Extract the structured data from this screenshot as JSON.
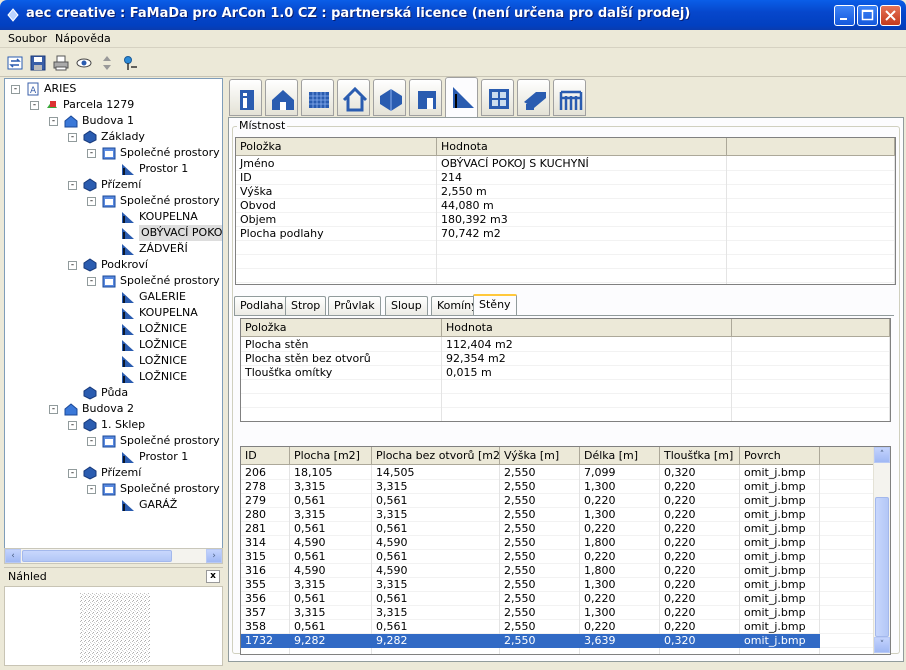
{
  "window": {
    "title": "aec creative : FaMaDa pro ArCon 1.0 CZ : partnerská licence (není určena pro další prodej)"
  },
  "menu": [
    "Soubor",
    "Nápověda"
  ],
  "toolbar": [
    {
      "name": "refresh-icon"
    },
    {
      "name": "save-icon"
    },
    {
      "name": "print-icon"
    },
    {
      "name": "view-icon"
    },
    {
      "name": "move-icon"
    },
    {
      "name": "pin-icon"
    }
  ],
  "tree": [
    {
      "label": "ARIES",
      "level": 0,
      "exp": "-",
      "icon": "project-icon"
    },
    {
      "label": "Parcela 1279",
      "level": 1,
      "exp": "-",
      "icon": "parcel-icon"
    },
    {
      "label": "Budova 1",
      "level": 2,
      "exp": "-",
      "icon": "building-icon"
    },
    {
      "label": "Základy",
      "level": 3,
      "exp": "-",
      "icon": "floor-icon"
    },
    {
      "label": "Společné prostory",
      "level": 4,
      "exp": "-",
      "icon": "space-group-icon"
    },
    {
      "label": "Prostor 1",
      "level": 5,
      "exp": "",
      "icon": "room-icon"
    },
    {
      "label": "Přízemí",
      "level": 3,
      "exp": "-",
      "icon": "floor-icon"
    },
    {
      "label": "Společné prostory",
      "level": 4,
      "exp": "-",
      "icon": "space-group-icon"
    },
    {
      "label": "KOUPELNA",
      "level": 5,
      "exp": "",
      "icon": "room-icon"
    },
    {
      "label": "OBÝVACÍ POKO",
      "level": 5,
      "exp": "",
      "icon": "room-icon",
      "selected": true
    },
    {
      "label": "ZÁDVEŘÍ",
      "level": 5,
      "exp": "",
      "icon": "room-icon"
    },
    {
      "label": "Podkroví",
      "level": 3,
      "exp": "-",
      "icon": "floor-icon"
    },
    {
      "label": "Společné prostory",
      "level": 4,
      "exp": "-",
      "icon": "space-group-icon"
    },
    {
      "label": "GALERIE",
      "level": 5,
      "exp": "",
      "icon": "room-icon"
    },
    {
      "label": "KOUPELNA",
      "level": 5,
      "exp": "",
      "icon": "room-icon"
    },
    {
      "label": "LOŽNICE",
      "level": 5,
      "exp": "",
      "icon": "room-icon"
    },
    {
      "label": "LOŽNICE",
      "level": 5,
      "exp": "",
      "icon": "room-icon"
    },
    {
      "label": "LOŽNICE",
      "level": 5,
      "exp": "",
      "icon": "room-icon"
    },
    {
      "label": "LOŽNICE",
      "level": 5,
      "exp": "",
      "icon": "room-icon"
    },
    {
      "label": "Půda",
      "level": 3,
      "exp": "",
      "icon": "floor-icon"
    },
    {
      "label": "Budova 2",
      "level": 2,
      "exp": "-",
      "icon": "building-icon"
    },
    {
      "label": "1. Sklep",
      "level": 3,
      "exp": "-",
      "icon": "floor-icon"
    },
    {
      "label": "Společné prostory",
      "level": 4,
      "exp": "-",
      "icon": "space-group-icon"
    },
    {
      "label": "Prostor 1",
      "level": 5,
      "exp": "",
      "icon": "room-icon"
    },
    {
      "label": "Přízemí",
      "level": 3,
      "exp": "-",
      "icon": "floor-icon"
    },
    {
      "label": "Společné prostory",
      "level": 4,
      "exp": "-",
      "icon": "space-group-icon"
    },
    {
      "label": "GARÁŽ",
      "level": 5,
      "exp": "",
      "icon": "room-icon"
    }
  ],
  "preview": {
    "title": "Náhled",
    "close": "x"
  },
  "big_tabs": [
    "info-icon",
    "building-icon",
    "parcel-grid-icon",
    "house-arrow-icon",
    "floor-icon",
    "door-icon",
    "room-icon",
    "window-icon",
    "roof-icon",
    "railing-icon"
  ],
  "room": {
    "group_label": "Místnost",
    "headers": [
      "Položka",
      "Hodnota"
    ],
    "rows": [
      [
        "Jméno",
        "OBÝVACÍ POKOJ S KUCHYNÍ"
      ],
      [
        "ID",
        "214"
      ],
      [
        "Výška",
        "2,550 m"
      ],
      [
        "Obvod",
        "44,080 m"
      ],
      [
        "Objem",
        "180,392 m3"
      ],
      [
        "Plocha podlahy",
        "70,742 m2"
      ]
    ]
  },
  "subtabs": [
    "Podlaha",
    "Strop",
    "Průvlak",
    "Sloup",
    "Komíny",
    "Stěny"
  ],
  "walls_summary": {
    "headers": [
      "Položka",
      "Hodnota"
    ],
    "rows": [
      [
        "Plocha stěn",
        "112,404 m2"
      ],
      [
        "Plocha stěn bez otvorů",
        "92,354 m2"
      ],
      [
        "Tloušťka omítky",
        "0,015 m"
      ]
    ]
  },
  "walls": {
    "headers": [
      "ID",
      "Plocha [m2]",
      "Plocha bez otvorů [m2]",
      "Výška [m]",
      "Délka [m]",
      "Tloušťka [m]",
      "Povrch"
    ],
    "rows": [
      [
        "206",
        "18,105",
        "14,505",
        "2,550",
        "7,099",
        "0,320",
        "omit_j.bmp"
      ],
      [
        "278",
        "3,315",
        "3,315",
        "2,550",
        "1,300",
        "0,220",
        "omit_j.bmp"
      ],
      [
        "279",
        "0,561",
        "0,561",
        "2,550",
        "0,220",
        "0,220",
        "omit_j.bmp"
      ],
      [
        "280",
        "3,315",
        "3,315",
        "2,550",
        "1,300",
        "0,220",
        "omit_j.bmp"
      ],
      [
        "281",
        "0,561",
        "0,561",
        "2,550",
        "0,220",
        "0,220",
        "omit_j.bmp"
      ],
      [
        "314",
        "4,590",
        "4,590",
        "2,550",
        "1,800",
        "0,220",
        "omit_j.bmp"
      ],
      [
        "315",
        "0,561",
        "0,561",
        "2,550",
        "0,220",
        "0,220",
        "omit_j.bmp"
      ],
      [
        "316",
        "4,590",
        "4,590",
        "2,550",
        "1,800",
        "0,220",
        "omit_j.bmp"
      ],
      [
        "355",
        "3,315",
        "3,315",
        "2,550",
        "1,300",
        "0,220",
        "omit_j.bmp"
      ],
      [
        "356",
        "0,561",
        "0,561",
        "2,550",
        "0,220",
        "0,220",
        "omit_j.bmp"
      ],
      [
        "357",
        "3,315",
        "3,315",
        "2,550",
        "1,300",
        "0,220",
        "omit_j.bmp"
      ],
      [
        "358",
        "0,561",
        "0,561",
        "2,550",
        "0,220",
        "0,220",
        "omit_j.bmp"
      ],
      [
        "1732",
        "9,282",
        "9,282",
        "2,550",
        "3,639",
        "0,320",
        "omit_j.bmp"
      ]
    ],
    "selected_row": 12
  },
  "colors": {
    "accent": "#316ac5",
    "title": "#0a5ee8"
  }
}
